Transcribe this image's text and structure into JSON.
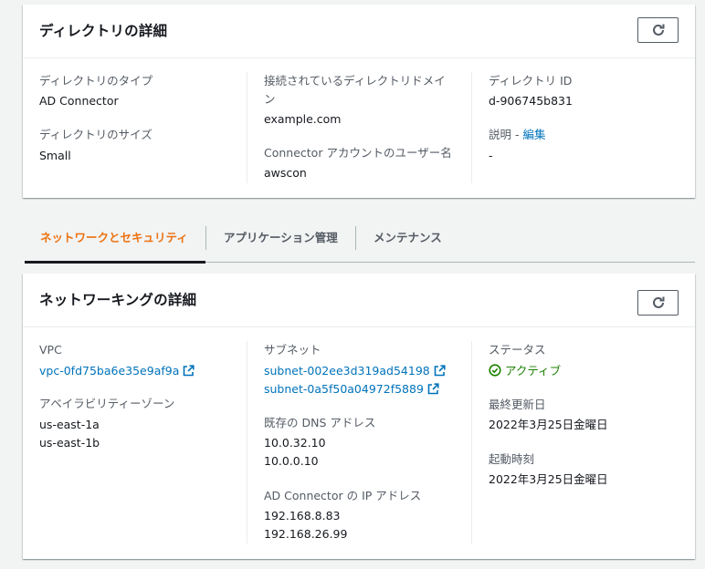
{
  "directory_panel": {
    "title": "ディレクトリの詳細",
    "type_label": "ディレクトリのタイプ",
    "type_value": "AD Connector",
    "size_label": "ディレクトリのサイズ",
    "size_value": "Small",
    "domain_label_line1": "接続されているディレクトリドメイ",
    "domain_label_line2": "ン",
    "domain_value": "example.com",
    "account_label": "Connector アカウントのユーザー名",
    "account_value": "awscon",
    "id_label": "ディレクトリ ID",
    "id_value": "d-906745b831",
    "desc_label": "説明 - ",
    "desc_edit": "編集",
    "desc_value": "-"
  },
  "tabs": [
    {
      "label": "ネットワークとセキュリティ",
      "active": true
    },
    {
      "label": "アプリケーション管理",
      "active": false
    },
    {
      "label": "メンテナンス",
      "active": false
    }
  ],
  "network_panel": {
    "title": "ネットワーキングの詳細",
    "vpc_label": "VPC",
    "vpc_value": "vpc-0fd75ba6e35e9af9a",
    "az_label": "アベイラビリティーゾーン",
    "az_values": [
      "us-east-1a",
      "us-east-1b"
    ],
    "subnet_label": "サブネット",
    "subnet_values": [
      "subnet-002ee3d319ad54198",
      "subnet-0a5f50a04972f5889"
    ],
    "dns_label": "既存の DNS アドレス",
    "dns_values": [
      "10.0.32.10",
      "10.0.0.10"
    ],
    "ip_label": "AD Connector の IP アドレス",
    "ip_values": [
      "192.168.8.83",
      "192.168.26.99"
    ],
    "status_label": "ステータス",
    "status_value": "アクティブ",
    "updated_label": "最終更新日",
    "updated_value": "2022年3月25日金曜日",
    "launch_label": "起動時刻",
    "launch_value": "2022年3月25日金曜日"
  },
  "colors": {
    "link": "#0073bb",
    "active_tab": "#ec7211",
    "status_ok": "#1d8102"
  },
  "icons": [
    "refresh-icon",
    "external-link-icon",
    "status-ok-icon"
  ]
}
